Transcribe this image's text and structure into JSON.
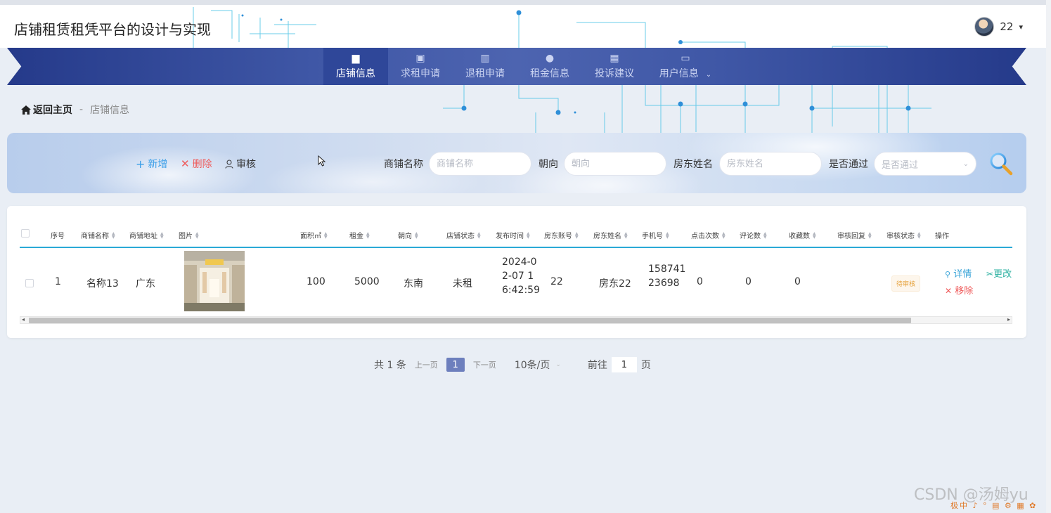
{
  "site": {
    "title": "店铺租赁租凭平台的设计与实现"
  },
  "user": {
    "name": "22",
    "avatar_icon": "avatar-photo",
    "caret": "▾"
  },
  "nav": {
    "items": [
      {
        "label": "店铺信息",
        "icon": "ticket-icon",
        "glyph": "▆"
      },
      {
        "label": "求租申请",
        "icon": "briefcase-icon",
        "glyph": "▣"
      },
      {
        "label": "退租申请",
        "icon": "book-icon",
        "glyph": "▥"
      },
      {
        "label": "租金信息",
        "icon": "user-icon",
        "glyph": "●"
      },
      {
        "label": "投诉建议",
        "icon": "grid-icon",
        "glyph": "▦"
      },
      {
        "label": "用户信息",
        "icon": "card-icon",
        "glyph": "▭",
        "caret": "⌄"
      }
    ]
  },
  "breadcrumb": {
    "home": "返回主页",
    "sep": "-",
    "current": "店铺信息"
  },
  "toolbar": {
    "add": "新增",
    "delete": "删除",
    "audit": "审核"
  },
  "filters": {
    "name_label": "商铺名称",
    "name_placeholder": "商铺名称",
    "dir_label": "朝向",
    "dir_placeholder": "朝向",
    "owner_label": "房东姓名",
    "owner_placeholder": "房东姓名",
    "pass_label": "是否通过",
    "pass_placeholder": "是否通过"
  },
  "table": {
    "columns": [
      "序号",
      "商铺名称",
      "商铺地址",
      "图片",
      "面积㎡",
      "租金",
      "朝向",
      "店铺状态",
      "发布时间",
      "房东账号",
      "房东姓名",
      "手机号",
      "点击次数",
      "评论数",
      "收藏数",
      "审核回复",
      "审核状态",
      "操作"
    ],
    "rows": [
      {
        "index": "1",
        "name": "名称13",
        "address": "广东",
        "area": "100",
        "rent": "5000",
        "direction": "东南",
        "status": "未租",
        "time_l1": "2024-0",
        "time_l2": "2-07 1",
        "time_l3": "6:42:59",
        "owner_account": "22",
        "owner_name": "房东22",
        "phone_l1": "158741",
        "phone_l2": "23698",
        "clicks": "0",
        "comments": "0",
        "favorites": "0",
        "reply": "",
        "audit": "待审核",
        "op_detail": "详情",
        "op_edit": "更改",
        "op_remove": "移除"
      }
    ]
  },
  "pagination": {
    "total": "共 1 条",
    "prev": "上一页",
    "page": "1",
    "next": "下一页",
    "size": "10条/页",
    "goto_prefix": "前往",
    "goto_value": "1",
    "goto_suffix": "页"
  },
  "watermark": "CSDN @汤姆yu",
  "ime": "极中 ♪ ° ▤ ⚙ ▦ ✿",
  "colors": {
    "nav": "#3f57a6",
    "accent": "#2aa9d6",
    "danger": "#ef5a5a",
    "warning": "#e6a23c"
  }
}
